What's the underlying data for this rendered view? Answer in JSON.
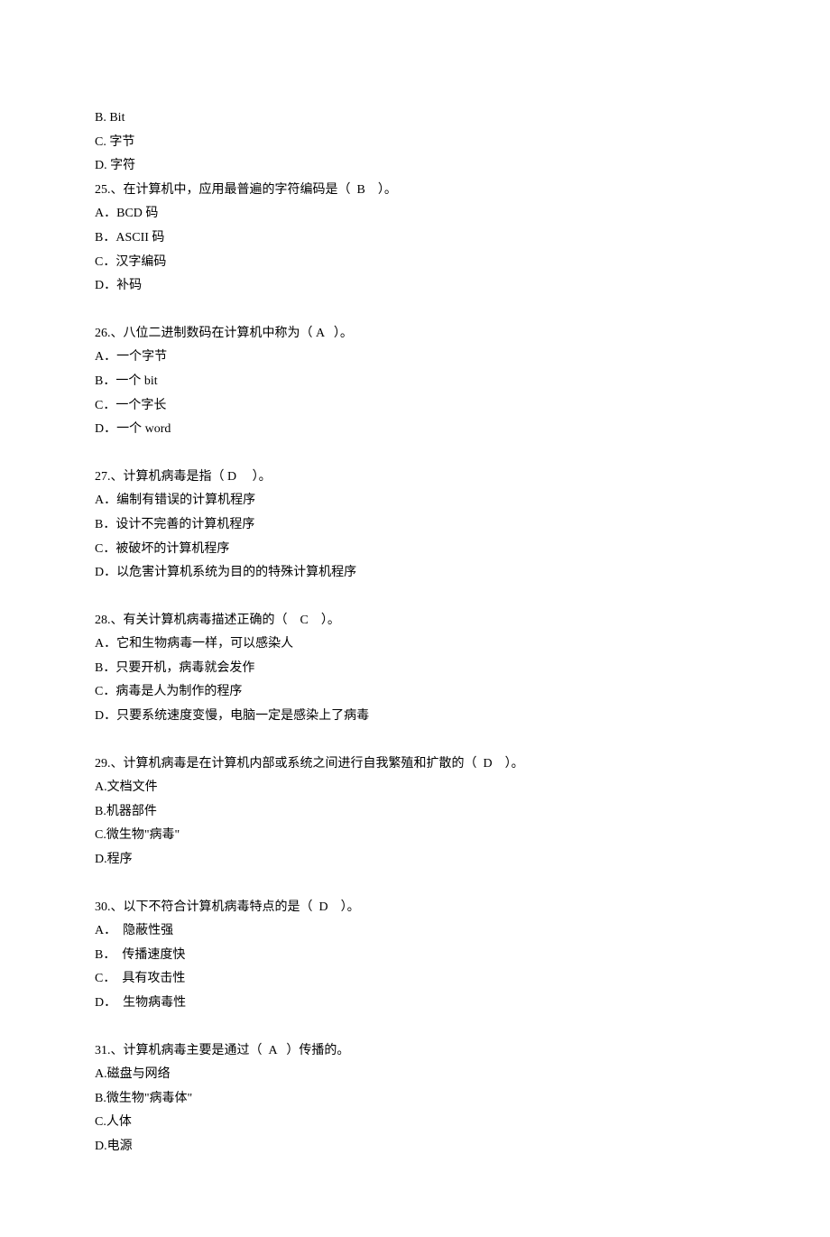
{
  "fragmentOptions": [
    {
      "label": "B",
      "text": "Bit",
      "sep": ". "
    },
    {
      "label": "C",
      "text": "字节",
      "sep": ". "
    },
    {
      "label": "D",
      "text": "字符",
      "sep": ". "
    }
  ],
  "questions": [
    {
      "number": "25.",
      "stem": "、在计算机中，应用最普遍的字符编码是（  B    ）。",
      "options": [
        {
          "label": "A",
          "text": "BCD 码",
          "sep": "．"
        },
        {
          "label": "B",
          "text": "ASCII 码",
          "sep": "．"
        },
        {
          "label": "C",
          "text": "汉字编码",
          "sep": "．"
        },
        {
          "label": "D",
          "text": "补码",
          "sep": "．"
        }
      ]
    },
    {
      "number": "26.",
      "stem": "、八位二进制数码在计算机中称为（ A   ）。",
      "options": [
        {
          "label": "A",
          "text": "一个字节",
          "sep": "．"
        },
        {
          "label": "B",
          "text": "一个 bit",
          "sep": "．"
        },
        {
          "label": "C",
          "text": "一个字长",
          "sep": "．"
        },
        {
          "label": "D",
          "text": "一个 word",
          "sep": "．"
        }
      ]
    },
    {
      "number": "27.",
      "stem": "、计算机病毒是指（ D     ）。",
      "options": [
        {
          "label": "A",
          "text": "编制有错误的计算机程序",
          "sep": "．"
        },
        {
          "label": "B",
          "text": "设计不完善的计算机程序",
          "sep": "．"
        },
        {
          "label": "C",
          "text": "被破坏的计算机程序",
          "sep": "．"
        },
        {
          "label": "D",
          "text": "以危害计算机系统为目的的特殊计算机程序",
          "sep": "．"
        }
      ]
    },
    {
      "number": "28.",
      "stem": "、有关计算机病毒描述正确的（    C    ）。",
      "options": [
        {
          "label": "A",
          "text": "它和生物病毒一样，可以感染人",
          "sep": "．"
        },
        {
          "label": "B",
          "text": "只要开机，病毒就会发作",
          "sep": "．"
        },
        {
          "label": "C",
          "text": "病毒是人为制作的程序",
          "sep": "．"
        },
        {
          "label": "D",
          "text": "只要系统速度变慢，电脑一定是感染上了病毒",
          "sep": "．"
        }
      ]
    },
    {
      "number": "29.",
      "stem": "、计算机病毒是在计算机内部或系统之间进行自我繁殖和扩散的（  D    ）。",
      "options": [
        {
          "label": "A",
          "text": "文档文件",
          "sep": "."
        },
        {
          "label": "B",
          "text": "机器部件",
          "sep": "."
        },
        {
          "label": "C",
          "text": "微生物\"病毒\"",
          "sep": "."
        },
        {
          "label": "D",
          "text": "程序",
          "sep": "."
        }
      ]
    },
    {
      "number": "30.",
      "stem": "、以下不符合计算机病毒特点的是（  D    ）。",
      "options": [
        {
          "label": "A",
          "text": " 隐蔽性强",
          "sep": "． "
        },
        {
          "label": "B",
          "text": " 传播速度快",
          "sep": "． "
        },
        {
          "label": "C",
          "text": " 具有攻击性",
          "sep": "． "
        },
        {
          "label": "D",
          "text": " 生物病毒性",
          "sep": "． "
        }
      ]
    },
    {
      "number": "31.",
      "stem": "、计算机病毒主要是通过（  A   ）传播的。",
      "options": [
        {
          "label": "A",
          "text": "磁盘与网络",
          "sep": "."
        },
        {
          "label": "B",
          "text": "微生物\"病毒体\"",
          "sep": "."
        },
        {
          "label": "C",
          "text": "人体",
          "sep": "."
        },
        {
          "label": "D",
          "text": "电源",
          "sep": "."
        }
      ]
    }
  ]
}
